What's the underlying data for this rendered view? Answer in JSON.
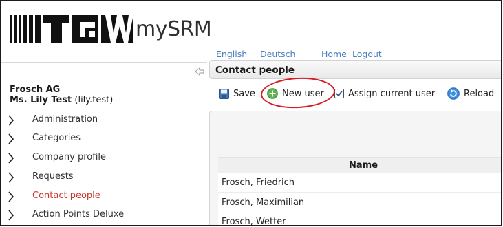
{
  "header": {
    "logo_text": "TGW",
    "app_name": "mySRM",
    "nav_links": [
      "English",
      "Deutsch",
      "Home",
      "Logout"
    ]
  },
  "user": {
    "company": "Frosch AG",
    "display_name": "Ms. Lily Test",
    "login": "(lily.test)"
  },
  "sidebar": {
    "items": [
      {
        "label": "Administration",
        "active": false
      },
      {
        "label": "Categories",
        "active": false
      },
      {
        "label": "Company profile",
        "active": false
      },
      {
        "label": "Requests",
        "active": false
      },
      {
        "label": "Contact people",
        "active": true
      },
      {
        "label": "Action Points Deluxe",
        "active": false
      }
    ]
  },
  "content": {
    "title": "Contact people"
  },
  "toolbar": {
    "save_label": "Save",
    "new_user_label": "New user",
    "assign_label": "Assign current user",
    "reload_label": "Reload"
  },
  "table": {
    "columns": [
      "Name"
    ],
    "rows": [
      "Frosch, Friedrich",
      "Frosch, Maximilian",
      "Frosch, Wetter"
    ]
  },
  "icons": {
    "save": "save-icon",
    "new_user": "add-icon",
    "assign": "checkbox-icon",
    "reload": "reload-icon",
    "collapse": "collapse-arrow-icon",
    "chevron": "chevron-right-icon"
  },
  "colors": {
    "link": "#4a7fbf",
    "active_nav": "#c8362b",
    "highlight": "#d81c25"
  }
}
